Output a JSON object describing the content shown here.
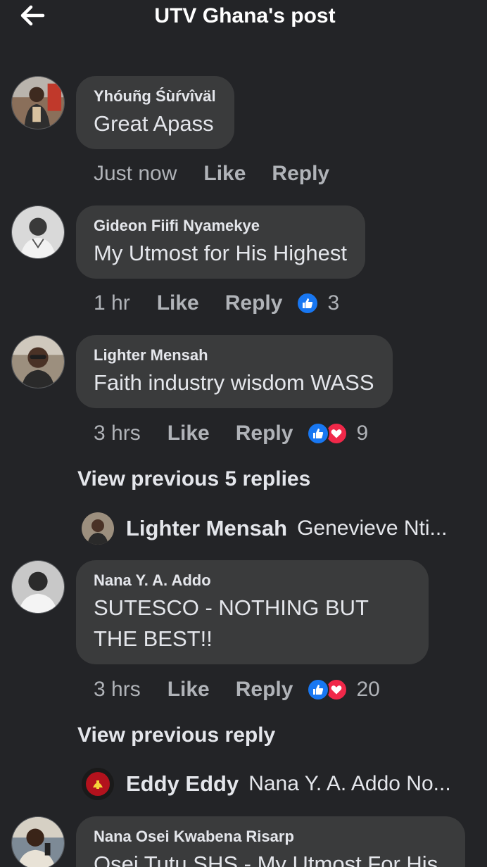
{
  "header": {
    "title": "UTV Ghana's post"
  },
  "comments": [
    {
      "author": "Yhóuñg Śùŕvîväl",
      "text": "Great Apass",
      "time": "Just now",
      "like": "Like",
      "reply": "Reply",
      "reactions": null
    },
    {
      "author": "Gideon Fiifi Nyamekye",
      "text": "My Utmost for His Highest",
      "time": "1 hr",
      "like": "Like",
      "reply": "Reply",
      "reactions": {
        "types": [
          "like"
        ],
        "count": "3"
      }
    },
    {
      "author": "Lighter Mensah",
      "text": "Faith industry wisdom WASS",
      "time": "3 hrs",
      "like": "Like",
      "reply": "Reply",
      "reactions": {
        "types": [
          "like",
          "love"
        ],
        "count": "9"
      }
    },
    {
      "author": "Nana Y. A. Addo",
      "text": "SUTESCO - NOTHING BUT THE BEST!!",
      "time": "3 hrs",
      "like": "Like",
      "reply": "Reply",
      "reactions": {
        "types": [
          "like",
          "love"
        ],
        "count": "20"
      }
    },
    {
      "author": "Nana Osei Kwabena Risarp",
      "text": "Osei Tutu SHS - My Utmost For His"
    }
  ],
  "view_previous": [
    "View previous 5 replies",
    "View previous reply"
  ],
  "reply_previews": [
    {
      "author": "Lighter Mensah",
      "text": "Genevieve Nti..."
    },
    {
      "author": "Eddy Eddy",
      "text": "Nana Y. A. Addo No..."
    }
  ],
  "colors": {
    "background": "#232427",
    "bubble": "#3a3b3c",
    "like_blue": "#1877f2",
    "love_red": "#f02849",
    "muted_text": "#b0b3b8"
  },
  "icons": {
    "back": "arrow-left-icon",
    "like": "thumbs-up-icon",
    "love": "heart-icon"
  }
}
